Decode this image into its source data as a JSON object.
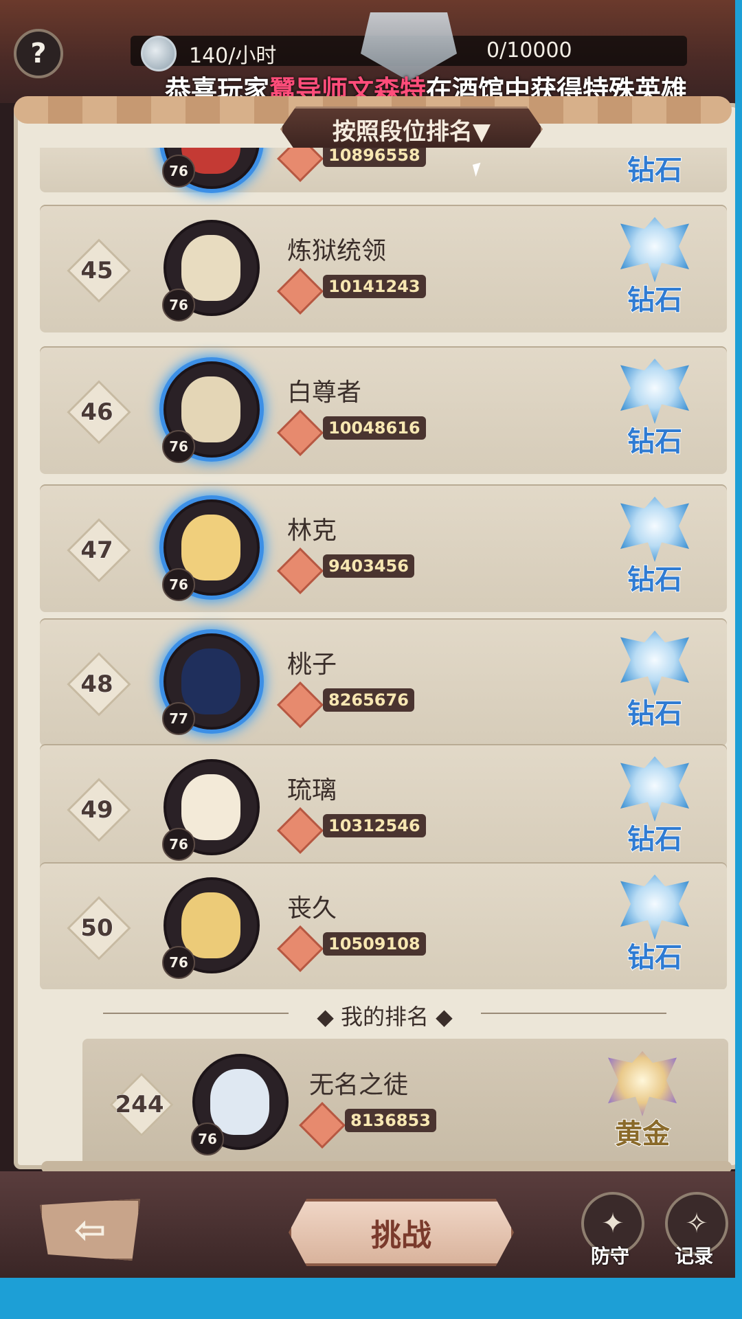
{
  "header": {
    "help_icon": "question-mark-icon",
    "rate_text": "140/小时",
    "cap_text": "0/10000",
    "ticker_prefix": "恭喜玩家",
    "ticker_highlight": "蠶导师文森特",
    "ticker_suffix": "在酒馆中获得特殊英雄"
  },
  "sort_tab": {
    "label": "按照段位排名▼"
  },
  "rows": [
    {
      "rank": "",
      "name": "",
      "level": "76",
      "power": "10896558",
      "tier": "钻石"
    },
    {
      "rank": "45",
      "name": "炼狱统领",
      "level": "76",
      "power": "10141243",
      "tier": "钻石"
    },
    {
      "rank": "46",
      "name": "白尊者",
      "level": "76",
      "power": "10048616",
      "tier": "钻石"
    },
    {
      "rank": "47",
      "name": "林克",
      "level": "76",
      "power": "9403456",
      "tier": "钻石"
    },
    {
      "rank": "48",
      "name": "桃子",
      "level": "77",
      "power": "8265676",
      "tier": "钻石"
    },
    {
      "rank": "49",
      "name": "琉璃",
      "level": "76",
      "power": "10312546",
      "tier": "钻石"
    },
    {
      "rank": "50",
      "name": "丧久",
      "level": "76",
      "power": "10509108",
      "tier": "钻石"
    }
  ],
  "divider": {
    "title": "◆  我的排名  ◆"
  },
  "my_rank": {
    "rank": "244",
    "name": "无名之徒",
    "level": "76",
    "power": "8136853",
    "tier": "黄金"
  },
  "bottom": {
    "back_icon": "back-arrow-icon",
    "challenge_label": "挑战",
    "defense_label": "防守",
    "record_label": "记录"
  },
  "colors": {
    "diamond": "#2f7bd2",
    "gold_tier": "#8a6a2a",
    "ticker_highlight": "#ff4d7a",
    "flame": "#3fa0f2"
  }
}
